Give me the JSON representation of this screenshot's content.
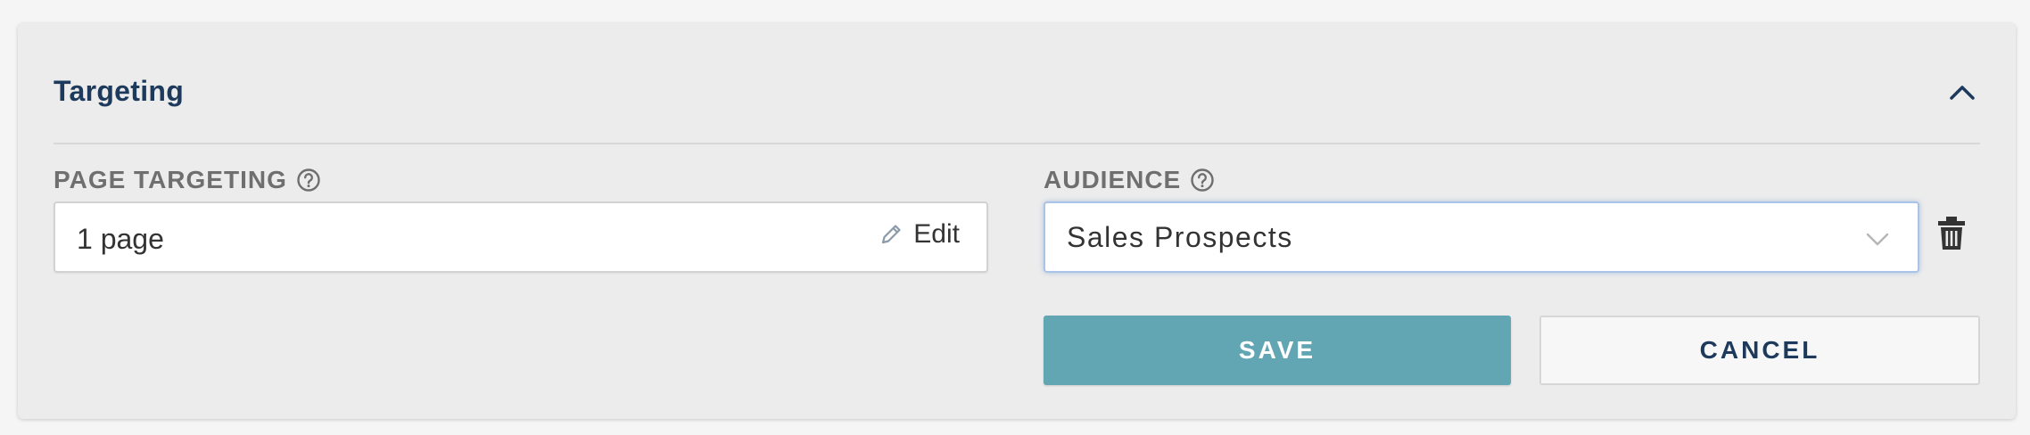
{
  "section": {
    "title": "Targeting",
    "collapse_icon": "chevron-up-icon"
  },
  "page_targeting": {
    "label": "PAGE TARGETING",
    "help_icon": "question-circle-icon",
    "value": "1 page",
    "edit_label": "Edit",
    "edit_icon": "pencil-icon"
  },
  "audience": {
    "label": "AUDIENCE",
    "help_icon": "question-circle-icon",
    "selected": "Sales Prospects",
    "dropdown_icon": "chevron-down-icon",
    "delete_icon": "trash-icon"
  },
  "actions": {
    "save_label": "SAVE",
    "cancel_label": "CANCEL"
  },
  "colors": {
    "title": "#1d3a5c",
    "save_bg": "#62a6b3",
    "panel_bg": "#ececec"
  }
}
